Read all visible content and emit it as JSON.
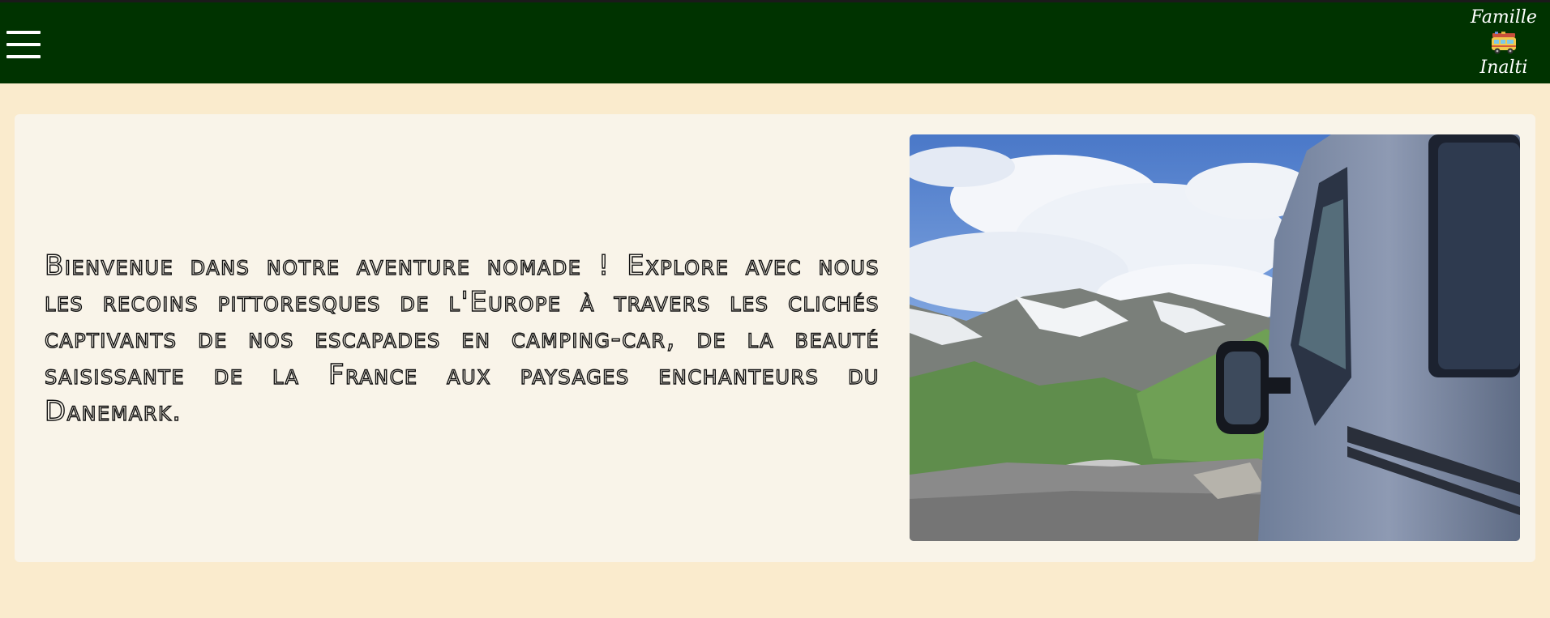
{
  "header": {
    "menu_icon": "hamburger-menu-icon",
    "logo": {
      "line1": "Famille",
      "line2": "Inalti",
      "icon": "camper-van-icon"
    },
    "bg_color": "#003300"
  },
  "page": {
    "bg_color": "#faebcd",
    "card_color": "#f9f4e9"
  },
  "main": {
    "intro_text": "Bienvenue dans notre aventure nomade ! Explore avec nous les recoins pittoresques de l'Europe à travers les clichés captivants de nos escapades en camping-car, de la beauté saisissante de la France aux paysages enchanteurs du Danemark.",
    "photo_icon": "camper-van-mountain-photo"
  }
}
